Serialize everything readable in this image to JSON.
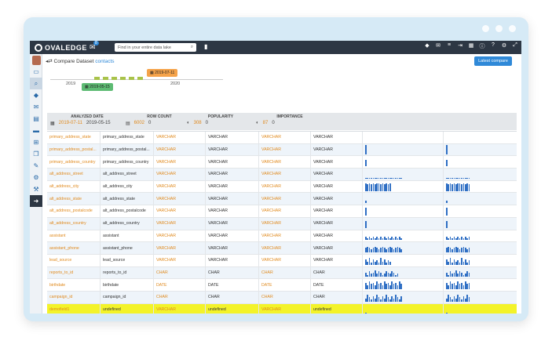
{
  "window": {
    "brand_color": "#2d3744",
    "accent_color": "#2f89d8"
  },
  "topbar": {
    "logo": "OVALEDGE",
    "chat_badge": "8",
    "search_placeholder": "Find in your entire data lake",
    "icons": [
      "tag-icon",
      "mail-icon",
      "list-icon",
      "logout-icon",
      "grid-icon",
      "info-icon",
      "help-icon",
      "settings-icon",
      "expand-icon"
    ]
  },
  "sidebar": {
    "items": [
      "avatar",
      "catalog-icon",
      "search-icon",
      "tag-icon",
      "mail-icon",
      "document-icon",
      "folder-icon",
      "query-icon",
      "copy-icon",
      "tools-icon",
      "settings-icon",
      "user-settings-icon",
      "next-icon"
    ]
  },
  "header": {
    "title": "Compare Dataset",
    "entity": "contacts",
    "latest_button": "Latest compare"
  },
  "timeline": {
    "year_left": "2019",
    "year_right": "2020",
    "selected_orange": "2019-07-11",
    "selected_green": "2019-05-15"
  },
  "stats": {
    "analyzed_label": "ANALYZED DATE",
    "analyzed_a": "2019-07-11",
    "analyzed_b": "2019-05-15",
    "rowcount_label": "ROW COUNT",
    "rowcount_a": "6002",
    "rowcount_b": "0",
    "popularity_label": "POPULARITY",
    "popularity_a": "308",
    "popularity_b": "0",
    "importance_label": "IMPORTANCE",
    "importance_a": "87",
    "importance_b": "0"
  },
  "rows": [
    {
      "a": "primary_address_state",
      "b": "primary_address_state",
      "ta": "VARCHAR",
      "tb": "VARCHAR",
      "tc": "VARCHAR",
      "td": "VARCHAR"
    },
    {
      "a": "primary_address_postal...",
      "b": "primary_address_postal...",
      "ta": "VARCHAR",
      "tb": "VARCHAR",
      "tc": "VARCHAR",
      "td": "VARCHAR"
    },
    {
      "a": "primary_address_country",
      "b": "primary_address_country",
      "ta": "VARCHAR",
      "tb": "VARCHAR",
      "tc": "VARCHAR",
      "td": "VARCHAR"
    },
    {
      "a": "alt_address_street",
      "b": "alt_address_street",
      "ta": "VARCHAR",
      "tb": "VARCHAR",
      "tc": "VARCHAR",
      "td": "VARCHAR"
    },
    {
      "a": "alt_address_city",
      "b": "alt_address_city",
      "ta": "VARCHAR",
      "tb": "VARCHAR",
      "tc": "VARCHAR",
      "td": "VARCHAR"
    },
    {
      "a": "alt_address_state",
      "b": "alt_address_state",
      "ta": "VARCHAR",
      "tb": "VARCHAR",
      "tc": "VARCHAR",
      "td": "VARCHAR"
    },
    {
      "a": "alt_address_postalcode",
      "b": "alt_address_postalcode",
      "ta": "VARCHAR",
      "tb": "VARCHAR",
      "tc": "VARCHAR",
      "td": "VARCHAR"
    },
    {
      "a": "alt_address_country",
      "b": "alt_address_country",
      "ta": "VARCHAR",
      "tb": "VARCHAR",
      "tc": "VARCHAR",
      "td": "VARCHAR"
    },
    {
      "a": "assistant",
      "b": "assistant",
      "ta": "VARCHAR",
      "tb": "VARCHAR",
      "tc": "VARCHAR",
      "td": "VARCHAR"
    },
    {
      "a": "assistant_phone",
      "b": "assistant_phone",
      "ta": "VARCHAR",
      "tb": "VARCHAR",
      "tc": "VARCHAR",
      "td": "VARCHAR"
    },
    {
      "a": "lead_source",
      "b": "lead_source",
      "ta": "VARCHAR",
      "tb": "VARCHAR",
      "tc": "VARCHAR",
      "td": "VARCHAR"
    },
    {
      "a": "reports_to_id",
      "b": "reports_to_id",
      "ta": "CHAR",
      "tb": "CHAR",
      "tc": "CHAR",
      "td": "CHAR"
    },
    {
      "a": "birthdate",
      "b": "birthdate",
      "ta": "DATE",
      "tb": "DATE",
      "tc": "DATE",
      "td": "DATE"
    },
    {
      "a": "campaign_id",
      "b": "campaign_id",
      "ta": "CHAR",
      "tb": "CHAR",
      "tc": "CHAR",
      "td": "CHAR"
    },
    {
      "a": "demofield1",
      "b": "undefined",
      "ta": "VARCHAR",
      "tb": "undefined",
      "tc": "VARCHAR",
      "td": "undefined"
    }
  ]
}
